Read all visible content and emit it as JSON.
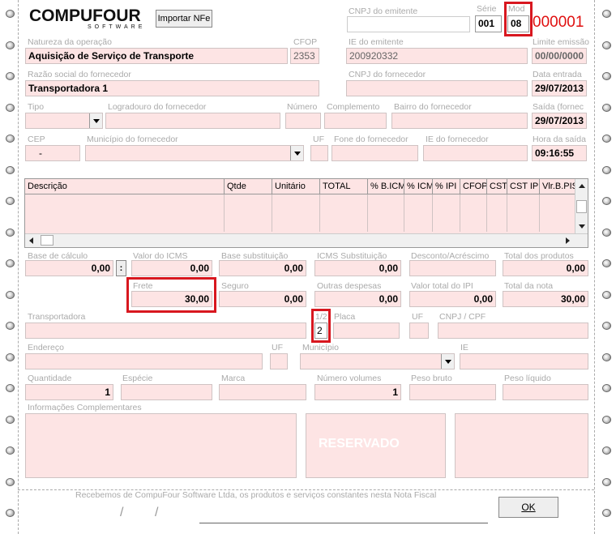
{
  "header": {
    "logo_main": "COMPUFOUR",
    "logo_sub": "SOFTWARE",
    "import_button": "Importar NFe",
    "cnpj_emitente_label": "CNPJ do emitente",
    "serie_label": "Série",
    "serie_value": "001",
    "mod_label": "Mod",
    "mod_value": "08",
    "doc_number": "000001"
  },
  "row1": {
    "natureza_label": "Natureza da operação",
    "natureza_value": "Aquisição de Serviço de Transporte",
    "cfop_label": "CFOP",
    "cfop_value": "2353",
    "ie_emitente_label": "IE do emitente",
    "ie_emitente_value": "200920332",
    "limite_label": "Limite emissão",
    "limite_value": "00/00/0000"
  },
  "row2": {
    "razao_label": "Razão social do fornecedor",
    "razao_value": "Transportadora 1",
    "cnpj_fornecedor_label": "CNPJ do fornecedor",
    "data_entrada_label": "Data entrada",
    "data_entrada_value": "29/07/2013"
  },
  "row3": {
    "tipo_label": "Tipo",
    "logradouro_label": "Logradouro do fornecedor",
    "numero_label": "Número",
    "complemento_label": "Complemento",
    "bairro_label": "Bairro do fornecedor",
    "saida_label": "Saída (fornec",
    "saida_value": "29/07/2013"
  },
  "row4": {
    "cep_label": "CEP",
    "cep_value": "-",
    "municipio_label": "Município do fornecedor",
    "uf_label": "UF",
    "fone_label": "Fone do fornecedor",
    "ie_fornecedor_label": "IE do fornecedor",
    "hora_label": "Hora da saída",
    "hora_value": "09:16:55"
  },
  "grid": {
    "columns": [
      "Descrição",
      "Qtde",
      "Unitário",
      "TOTAL",
      "% B.ICM",
      "% ICM",
      "% IPI",
      "CFOP",
      "CST",
      "CST IPI",
      "Vlr.B.PIS"
    ]
  },
  "totals1": {
    "base_calculo_label": "Base de cálculo",
    "base_calculo_value": "0,00",
    "colon_button": ":",
    "valor_icms_label": "Valor do ICMS",
    "valor_icms_value": "0,00",
    "base_subst_label": "Base substituição",
    "base_subst_value": "0,00",
    "icms_subst_label": "ICMS Substituição",
    "icms_subst_value": "0,00",
    "desconto_label": "Desconto/Acréscimo",
    "total_produtos_label": "Total dos produtos",
    "total_produtos_value": "0,00"
  },
  "totals2": {
    "frete_label": "Frete",
    "frete_value": "30,00",
    "seguro_label": "Seguro",
    "seguro_value": "0,00",
    "outras_label": "Outras despesas",
    "outras_value": "0,00",
    "total_ipi_label": "Valor total do IPI",
    "total_ipi_value": "0,00",
    "total_nota_label": "Total da nota",
    "total_nota_value": "30,00"
  },
  "transport": {
    "transportadora_label": "Transportadora",
    "frete_mod_label": "1/2",
    "frete_mod_value": "2",
    "placa_label": "Placa",
    "uf_label": "UF",
    "cnpj_cpf_label": "CNPJ / CPF",
    "endereco_label": "Endereço",
    "uf2_label": "UF",
    "municipio_label": "Município",
    "ie_label": "IE"
  },
  "volumes": {
    "quantidade_label": "Quantidade",
    "quantidade_value": "1",
    "especie_label": "Espécie",
    "marca_label": "Marca",
    "numero_volumes_label": "Número volumes",
    "numero_volumes_value": "1",
    "peso_bruto_label": "Peso bruto",
    "peso_liquido_label": "Peso líquido"
  },
  "info": {
    "info_label": "Informações Complementares",
    "reservado": "RESERVADO"
  },
  "footer": {
    "receipt_text": "Recebemos de CompuFour Software Ltda, os produtos e serviços constantes nesta Nota Fiscal",
    "ok_button": "OK"
  },
  "colors": {
    "field_bg": "#fde4e4",
    "highlight": "#d8171f",
    "doc_number": "#e01010"
  }
}
